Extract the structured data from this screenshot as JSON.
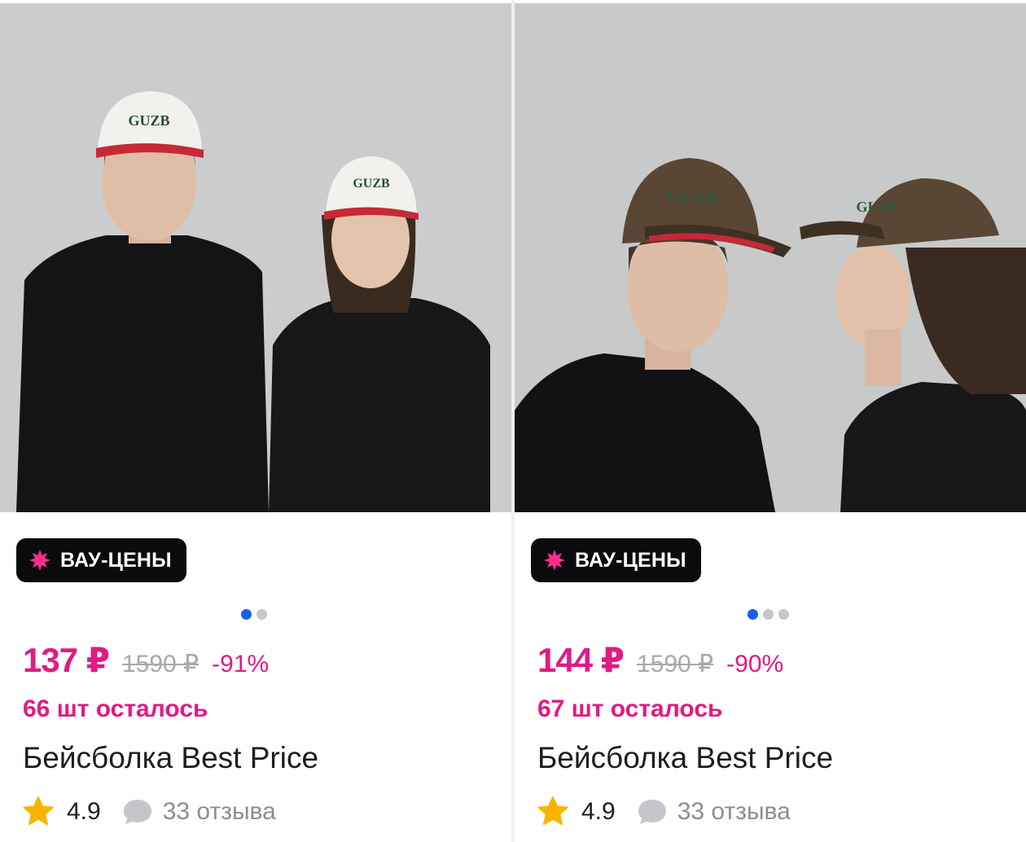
{
  "colors": {
    "accent_pink": "#e21a83",
    "dot_active": "#1a5cf2",
    "dot_inactive": "#c5c7cc",
    "badge_bg": "#0b0b0d",
    "star": "#f7b500",
    "cap_white_print": "#f2f1ee",
    "cap_brown_print": "#5a4634"
  },
  "products": [
    {
      "photo": {
        "description_icon": "white-guzb-cap-photo",
        "cap_text": "GUZB"
      },
      "badge": {
        "icon": "sparkle-icon",
        "label": "ВАУ-ЦЕНЫ"
      },
      "carousel": {
        "count": 2,
        "active": 0
      },
      "price": "137 ₽",
      "old_price": "1590 ₽",
      "discount": "-91%",
      "stock": "66 шт осталось",
      "title": "Бейсболка Best Price",
      "rating": "4.9",
      "reviews": "33 отзыва"
    },
    {
      "photo": {
        "description_icon": "brown-guzb-cap-photo",
        "cap_text": "GUZB"
      },
      "badge": {
        "icon": "sparkle-icon",
        "label": "ВАУ-ЦЕНЫ"
      },
      "carousel": {
        "count": 3,
        "active": 0
      },
      "price": "144 ₽",
      "old_price": "1590 ₽",
      "discount": "-90%",
      "stock": "67 шт осталось",
      "title": "Бейсболка Best Price",
      "rating": "4.9",
      "reviews": "33 отзыва"
    }
  ]
}
